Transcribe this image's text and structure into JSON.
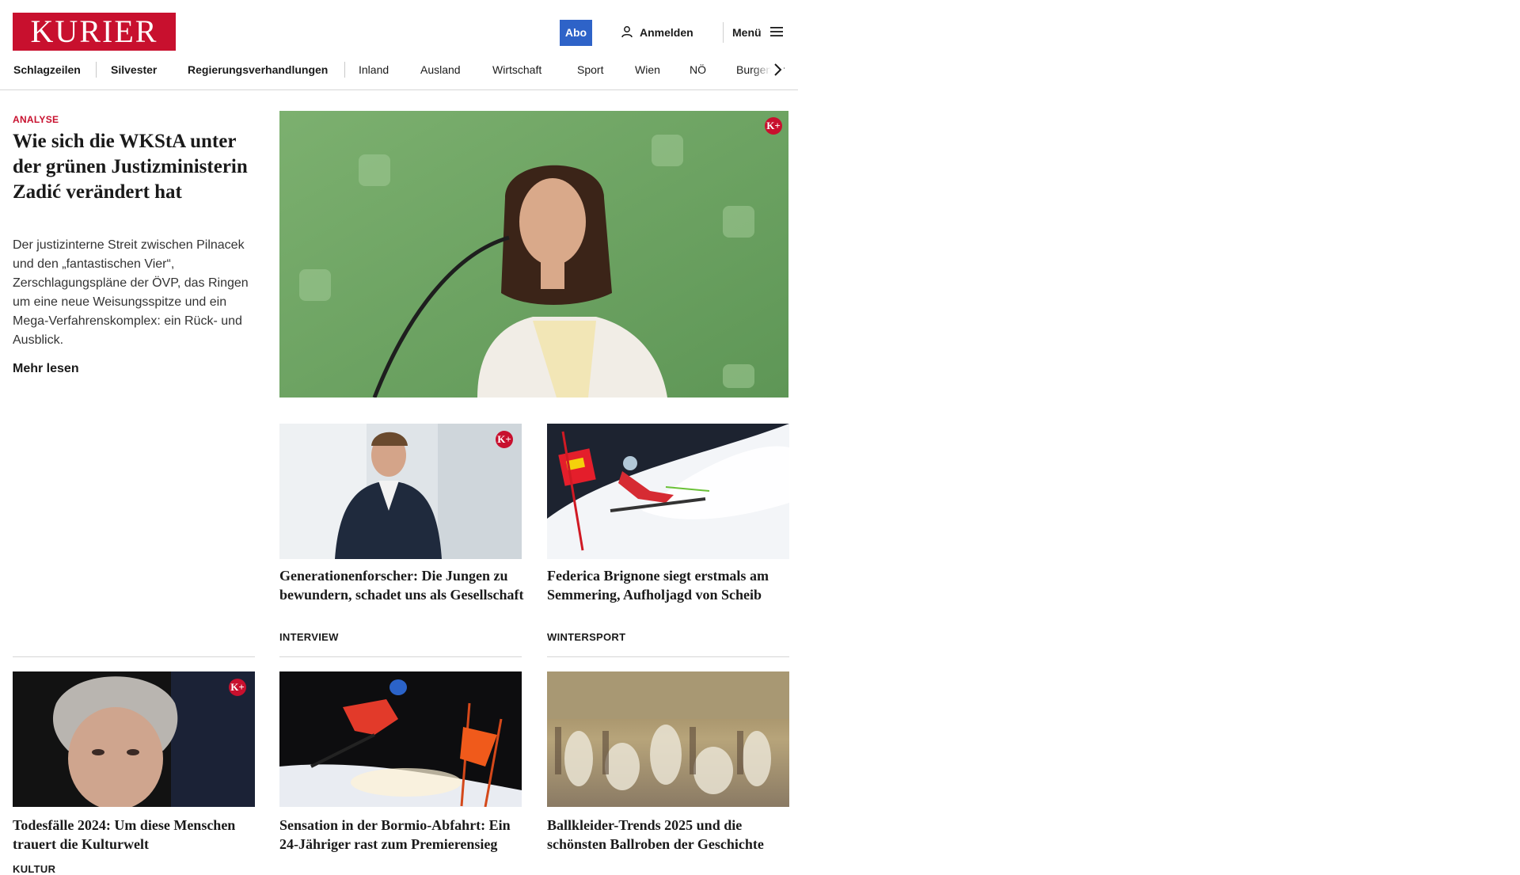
{
  "header": {
    "logo_text": "KURIER",
    "abo_label": "Abo",
    "login_label": "Anmelden",
    "menu_label": "Menü"
  },
  "nav": {
    "items": [
      "Schlagzeilen",
      "Silvester",
      "Regierungsverhandlungen",
      "Inland",
      "Ausland",
      "Wirtschaft",
      "Sport",
      "Wien",
      "NÖ",
      "Burgenland"
    ]
  },
  "lead": {
    "kicker": "ANALYSE",
    "title": "Wie sich die WKStA un­ter der grünen Justizmi­nisterin Zadić verändert hat",
    "teaser": "Der justizinterne Streit zwischen Pilnacek und den „fantastischen Vier“, Zerschlagungspläne der ÖVP, das Ringen um eine neue Weisungsspitze und ein Mega-Verfahrenskomplex: ein Rück- und Ausblick.",
    "more_label": "Mehr lesen",
    "badge": "K+"
  },
  "cards": [
    {
      "title": "Generationenforscher: Die Jungen zu bewundern, schadet uns als Gesellschaft",
      "category": "INTERVIEW",
      "badge": "K+"
    },
    {
      "title": "Federica Brignone siegt erstmals am Semmering, Aufholjagd von Scheib",
      "category": "WINTERSPORT"
    },
    {
      "title": "Todesfälle 2024: Um diese Men­schen trauert die Kulturwelt",
      "category": "KULTUR",
      "badge": "K+"
    },
    {
      "title": "Sensation in der Bormio-Abfahrt: Ein 24-Jähriger rast zum Premierensieg",
      "category": ""
    },
    {
      "title": "Ballkleider-Trends 2025 und die schönsten Ballroben der Geschichte",
      "category": ""
    }
  ],
  "colors": {
    "brand": "#c8102e",
    "abo": "#2e63c8",
    "lead_image_bg": "#6fa564"
  },
  "icons": {
    "login": "user-icon",
    "menu": "hamburger-icon",
    "nav_next": "chevron-right-icon"
  }
}
